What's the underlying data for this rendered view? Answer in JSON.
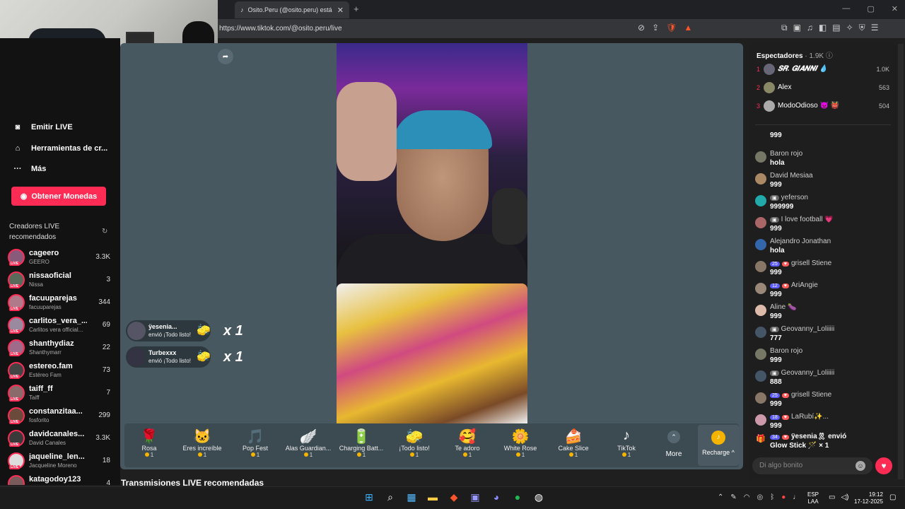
{
  "browser": {
    "tab_title": "Osito.Peru (@osito.peru) está",
    "url": "https://www.tiktok.com/@osito.peru/live"
  },
  "sidebar": {
    "nav": [
      {
        "label": "Emitir LIVE",
        "icon": "camera-icon"
      },
      {
        "label": "Herramientas de cr...",
        "icon": "home-icon"
      },
      {
        "label": "Más",
        "icon": "more-icon"
      }
    ],
    "coins_button": "Obtener Monedas",
    "recommended_title": "Creadores LIVE recomendados",
    "creators": [
      {
        "name": "cageero",
        "sub": "GEERO",
        "viewers": "3.3K"
      },
      {
        "name": "nissaoficial",
        "sub": "Nissa",
        "viewers": "3"
      },
      {
        "name": "facuuparejas",
        "sub": "facuuparejas",
        "viewers": "344"
      },
      {
        "name": "carlitos_vera_...",
        "sub": "Carlitos vera official...",
        "viewers": "69"
      },
      {
        "name": "shanthydiaz",
        "sub": "Shanthymarr",
        "viewers": "22"
      },
      {
        "name": "estereo.fam",
        "sub": "Estéreo Fam",
        "viewers": "73"
      },
      {
        "name": "taiff_ff",
        "sub": "Taiff",
        "viewers": "7"
      },
      {
        "name": "constanzitaa...",
        "sub": "fosforito",
        "viewers": "299"
      },
      {
        "name": "davidcanales...",
        "sub": "David Canales",
        "viewers": "3.3K"
      },
      {
        "name": "jaqueline_len...",
        "sub": "Jacqueline Moreno",
        "viewers": "18"
      },
      {
        "name": "katagodoy123",
        "sub": "",
        "viewers": "4"
      }
    ]
  },
  "gift_alerts": [
    {
      "name": "ÿesenia...",
      "message": "envió ¡Todo listo!",
      "multiplier": "x 1"
    },
    {
      "name": "Turbexxx",
      "message": "envió ¡Todo listo!",
      "multiplier": "x 1"
    }
  ],
  "gifts": [
    {
      "label": "Rosa",
      "price": "1",
      "icon": "rose-icon",
      "glyph": "🌹"
    },
    {
      "label": "Eres increíble",
      "price": "1",
      "icon": "cat-icon",
      "glyph": "🐱"
    },
    {
      "label": "Pop Fest",
      "price": "1",
      "icon": "pop-icon",
      "glyph": "🎵"
    },
    {
      "label": "Alas Guardian...",
      "price": "1",
      "icon": "wings-icon",
      "glyph": "🪽"
    },
    {
      "label": "Charging Batt...",
      "price": "1",
      "icon": "battery-icon",
      "glyph": "🔋"
    },
    {
      "label": "¡Todo listo!",
      "price": "1",
      "icon": "sponge-icon",
      "glyph": "🧽"
    },
    {
      "label": "Te adoro",
      "price": "1",
      "icon": "heart-face-icon",
      "glyph": "🥰"
    },
    {
      "label": "White Rose",
      "price": "1",
      "icon": "white-rose-icon",
      "glyph": "🌼"
    },
    {
      "label": "Cake Slice",
      "price": "1",
      "icon": "cake-icon",
      "glyph": "🍰"
    },
    {
      "label": "TikTok",
      "price": "1",
      "icon": "tiktok-icon",
      "glyph": "♪"
    }
  ],
  "more_label": "More",
  "recharge_label": "Recharge ^",
  "bottom_section_title": "Transmisiones LIVE recomendadas",
  "chat": {
    "viewers_title": "Espectadores",
    "viewers_count": "· 1.9K",
    "top_viewers": [
      {
        "rank": "1",
        "name": "𝑺𝑹. 𝑮𝑰𝑨𝑵𝑵𝑰 💧",
        "score": "1.0K"
      },
      {
        "rank": "2",
        "name": "Alex",
        "score": "563"
      },
      {
        "rank": "3",
        "name": "ModoOdioso 👿 👹",
        "score": "504"
      }
    ],
    "messages": [
      {
        "name": "Baron rojo",
        "text": "hola",
        "badges": []
      },
      {
        "name": "David Mesiaa",
        "text": "999",
        "badges": []
      },
      {
        "name": "yeferson",
        "text": "999999",
        "badges": [
          "g"
        ]
      },
      {
        "name": "I love football 💗",
        "text": "999",
        "badges": [
          "g"
        ]
      },
      {
        "name": "Alejandro Jonathan",
        "text": "hola",
        "badges": []
      },
      {
        "name": "grisell Stiene",
        "text": "999",
        "badges": [
          "25",
          "r"
        ]
      },
      {
        "name": "AriAngie",
        "text": "999",
        "badges": [
          "12",
          "r"
        ]
      },
      {
        "name": "Aline 🍆",
        "text": "999",
        "badges": []
      },
      {
        "name": "Geovanny_Loliiiii",
        "text": "777",
        "badges": [
          "g"
        ]
      },
      {
        "name": "Baron rojo",
        "text": "999",
        "badges": []
      },
      {
        "name": "Geovanny_Loliiiii",
        "text": "888",
        "badges": [
          "g"
        ]
      },
      {
        "name": "grisell Stiene",
        "text": "999",
        "badges": [
          "25",
          "r"
        ]
      },
      {
        "name": "LaRubí✨...",
        "text": "999",
        "badges": [
          "18",
          "r"
        ]
      },
      {
        "name": "ÿesenia🎗 envió",
        "text": "Glow Stick 🪄 × 1",
        "badges": [
          "34",
          "r"
        ]
      }
    ],
    "partial_top_text": "999",
    "input_placeholder": "Di algo bonito"
  },
  "taskbar": {
    "lang": "ESP",
    "lang2": "LAA",
    "time": "19:12",
    "date": "17-12-2025"
  }
}
